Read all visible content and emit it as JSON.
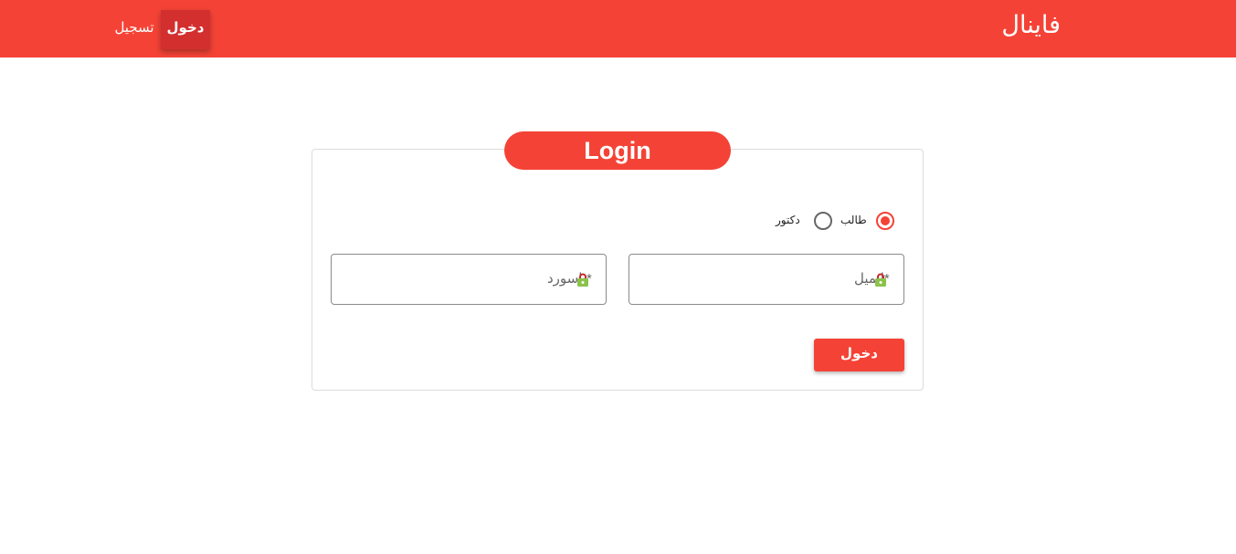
{
  "header": {
    "brand": "فاينال",
    "nav": {
      "login": "دخول",
      "register": "تسجيل"
    }
  },
  "login_card": {
    "title": "Login",
    "role_options": [
      {
        "label": "طالب",
        "selected": true
      },
      {
        "label": "دكتور",
        "selected": false
      }
    ],
    "fields": {
      "username": {
        "label": "ايميل*",
        "value": ""
      },
      "password": {
        "label": "باسورد*",
        "value": ""
      }
    },
    "submit_label": "دخول"
  },
  "icons": {
    "nav": "none",
    "field_badge": "password-manager-lock-icon",
    "radio": "radio-button"
  },
  "colors": {
    "primary": "#f44336",
    "primary_dark": "#d32f2f",
    "text_light": "#ffffff",
    "border": "#8a8a8a"
  }
}
